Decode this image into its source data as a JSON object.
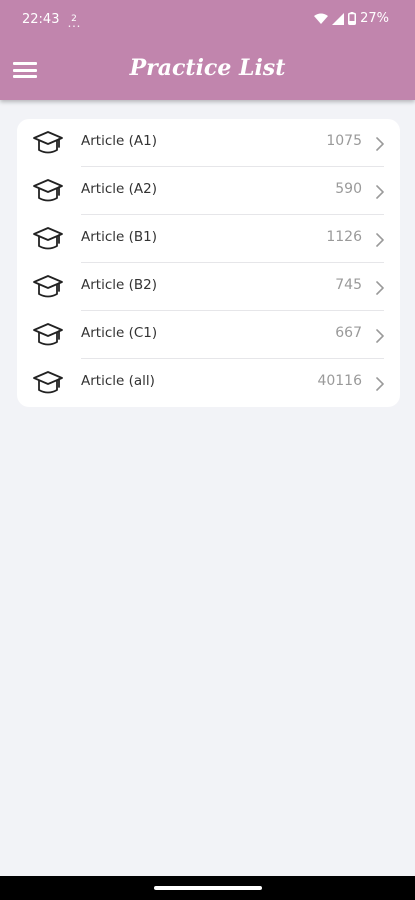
{
  "status": {
    "time": "22:43",
    "battery": "27%"
  },
  "appbar": {
    "title": "Practice List",
    "menu_icon": "hamburger-menu-icon",
    "color": "#c185ad"
  },
  "list": {
    "items": [
      {
        "label": "Article (A1)",
        "count": "1075",
        "icon": "graduation-cap-icon"
      },
      {
        "label": "Article (A2)",
        "count": "590",
        "icon": "graduation-cap-icon"
      },
      {
        "label": "Article (B1)",
        "count": "1126",
        "icon": "graduation-cap-icon"
      },
      {
        "label": "Article (B2)",
        "count": "745",
        "icon": "graduation-cap-icon"
      },
      {
        "label": "Article (C1)",
        "count": "667",
        "icon": "graduation-cap-icon"
      },
      {
        "label": "Article (all)",
        "count": "40116",
        "icon": "graduation-cap-icon"
      }
    ]
  }
}
